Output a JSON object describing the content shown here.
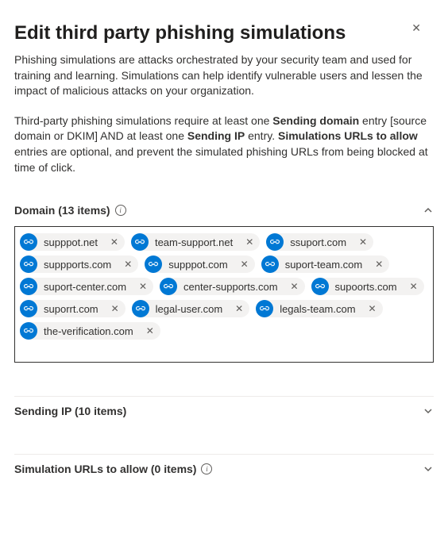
{
  "page": {
    "title": "Edit third party phishing simulations",
    "intro": "Phishing simulations are attacks orchestrated by your security team and used for training and learning. Simulations can help identify vulnerable users and lessen the impact of malicious attacks on your organization.",
    "req_pre": "Third-party phishing simulations require at least one ",
    "req_b1": "Sending domain",
    "req_mid1": " entry [source domain or DKIM] AND at least one ",
    "req_b2": "Sending IP",
    "req_mid2": " entry. ",
    "req_b3": "Simulations URLs to allow",
    "req_post": " entries are optional, and prevent the simulated phishing URLs from being blocked at time of click."
  },
  "sections": {
    "domain": {
      "label": "Domain (13 items)"
    },
    "sending_ip": {
      "label": "Sending IP (10 items)"
    },
    "sim_urls": {
      "label": "Simulation URLs to allow (0 items)"
    }
  },
  "domains": [
    "supppot.net",
    "team-support.net",
    "ssuport.com",
    "suppports.com",
    "supppot.com",
    "suport-team.com",
    "suport-center.com",
    "center-supports.com",
    "supoorts.com",
    "suporrt.com",
    "legal-user.com",
    "legals-team.com",
    "the-verification.com"
  ]
}
